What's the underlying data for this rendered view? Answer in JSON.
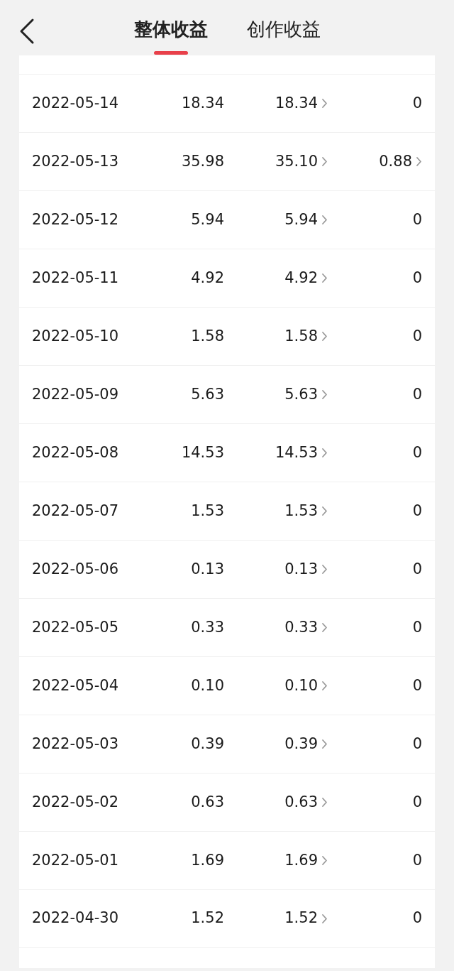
{
  "tabs": [
    {
      "label": "整体收益",
      "selected": true
    },
    {
      "label": "创作收益",
      "selected": false
    }
  ],
  "rows": [
    {
      "date": "2022-05-14",
      "column_2": "18.34",
      "column_3": {
        "value": "18.34",
        "link": true
      },
      "column_4": {
        "value": "0",
        "link": false
      }
    },
    {
      "date": "2022-05-13",
      "column_2": "35.98",
      "column_3": {
        "value": "35.10",
        "link": true
      },
      "column_4": {
        "value": "0.88",
        "link": true
      }
    },
    {
      "date": "2022-05-12",
      "column_2": "5.94",
      "column_3": {
        "value": "5.94",
        "link": true
      },
      "column_4": {
        "value": "0",
        "link": false
      }
    },
    {
      "date": "2022-05-11",
      "column_2": "4.92",
      "column_3": {
        "value": "4.92",
        "link": true
      },
      "column_4": {
        "value": "0",
        "link": false
      }
    },
    {
      "date": "2022-05-10",
      "column_2": "1.58",
      "column_3": {
        "value": "1.58",
        "link": true
      },
      "column_4": {
        "value": "0",
        "link": false
      }
    },
    {
      "date": "2022-05-09",
      "column_2": "5.63",
      "column_3": {
        "value": "5.63",
        "link": true
      },
      "column_4": {
        "value": "0",
        "link": false
      }
    },
    {
      "date": "2022-05-08",
      "column_2": "14.53",
      "column_3": {
        "value": "14.53",
        "link": true
      },
      "column_4": {
        "value": "0",
        "link": false
      }
    },
    {
      "date": "2022-05-07",
      "column_2": "1.53",
      "column_3": {
        "value": "1.53",
        "link": true
      },
      "column_4": {
        "value": "0",
        "link": false
      }
    },
    {
      "date": "2022-05-06",
      "column_2": "0.13",
      "column_3": {
        "value": "0.13",
        "link": true
      },
      "column_4": {
        "value": "0",
        "link": false
      }
    },
    {
      "date": "2022-05-05",
      "column_2": "0.33",
      "column_3": {
        "value": "0.33",
        "link": true
      },
      "column_4": {
        "value": "0",
        "link": false
      }
    },
    {
      "date": "2022-05-04",
      "column_2": "0.10",
      "column_3": {
        "value": "0.10",
        "link": true
      },
      "column_4": {
        "value": "0",
        "link": false
      }
    },
    {
      "date": "2022-05-03",
      "column_2": "0.39",
      "column_3": {
        "value": "0.39",
        "link": true
      },
      "column_4": {
        "value": "0",
        "link": false
      }
    },
    {
      "date": "2022-05-02",
      "column_2": "0.63",
      "column_3": {
        "value": "0.63",
        "link": true
      },
      "column_4": {
        "value": "0",
        "link": false
      }
    },
    {
      "date": "2022-05-01",
      "column_2": "1.69",
      "column_3": {
        "value": "1.69",
        "link": true
      },
      "column_4": {
        "value": "0",
        "link": false
      }
    },
    {
      "date": "2022-04-30",
      "column_2": "1.52",
      "column_3": {
        "value": "1.52",
        "link": true
      },
      "column_4": {
        "value": "0",
        "link": false
      }
    }
  ]
}
